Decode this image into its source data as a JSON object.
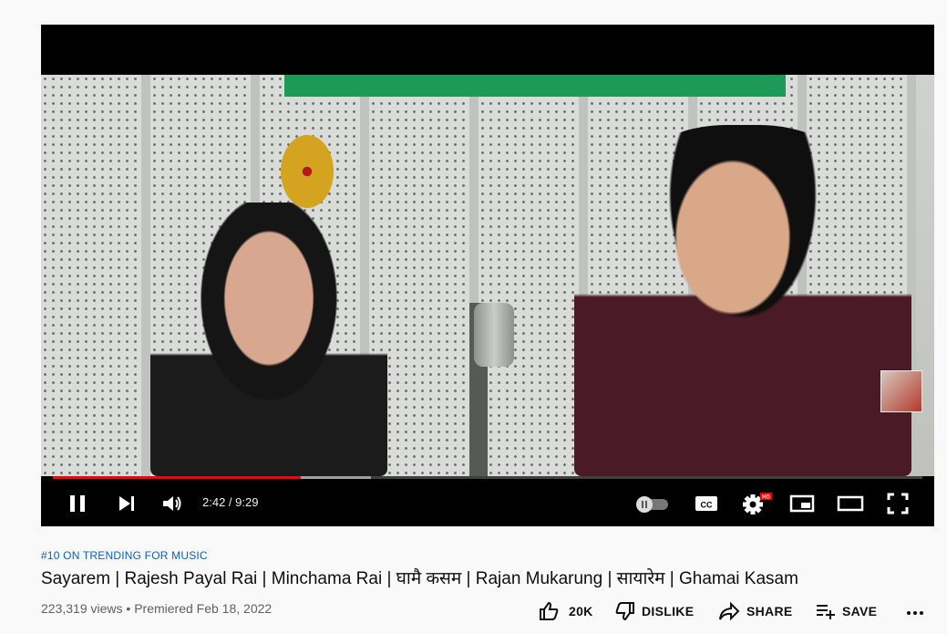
{
  "player": {
    "current_time": "2:42",
    "duration": "9:29",
    "time_display": "2:42 / 9:29",
    "progress_fraction": 0.285,
    "buffered_fraction": 0.366,
    "settings_badge": "HD",
    "icons": {
      "pause": "pause-icon",
      "next": "next-icon",
      "volume": "volume-icon",
      "autoplay": "autoplay-toggle-icon",
      "captions": "captions-icon",
      "settings": "gear-icon",
      "miniplayer": "miniplayer-icon",
      "theater": "theater-mode-icon",
      "fullscreen": "fullscreen-icon"
    },
    "accent_color": "#ff0000"
  },
  "video": {
    "trending": "#10 ON TRENDING FOR MUSIC",
    "title": "Sayarem | Rajesh Payal Rai | Minchama Rai | घामै कसम | Rajan Mukarung | सायारेम | Ghamai Kasam",
    "views": "223,319 views",
    "separator": "•",
    "premiered": "Premiered Feb 18, 2022"
  },
  "actions": {
    "like_count": "20K",
    "dislike_label": "DISLIKE",
    "share_label": "SHARE",
    "save_label": "SAVE",
    "more_label": "..."
  },
  "colors": {
    "link_blue": "#065fd4",
    "text_primary": "#0f0f0f",
    "text_secondary": "#606060",
    "background": "#f9f9f9"
  }
}
